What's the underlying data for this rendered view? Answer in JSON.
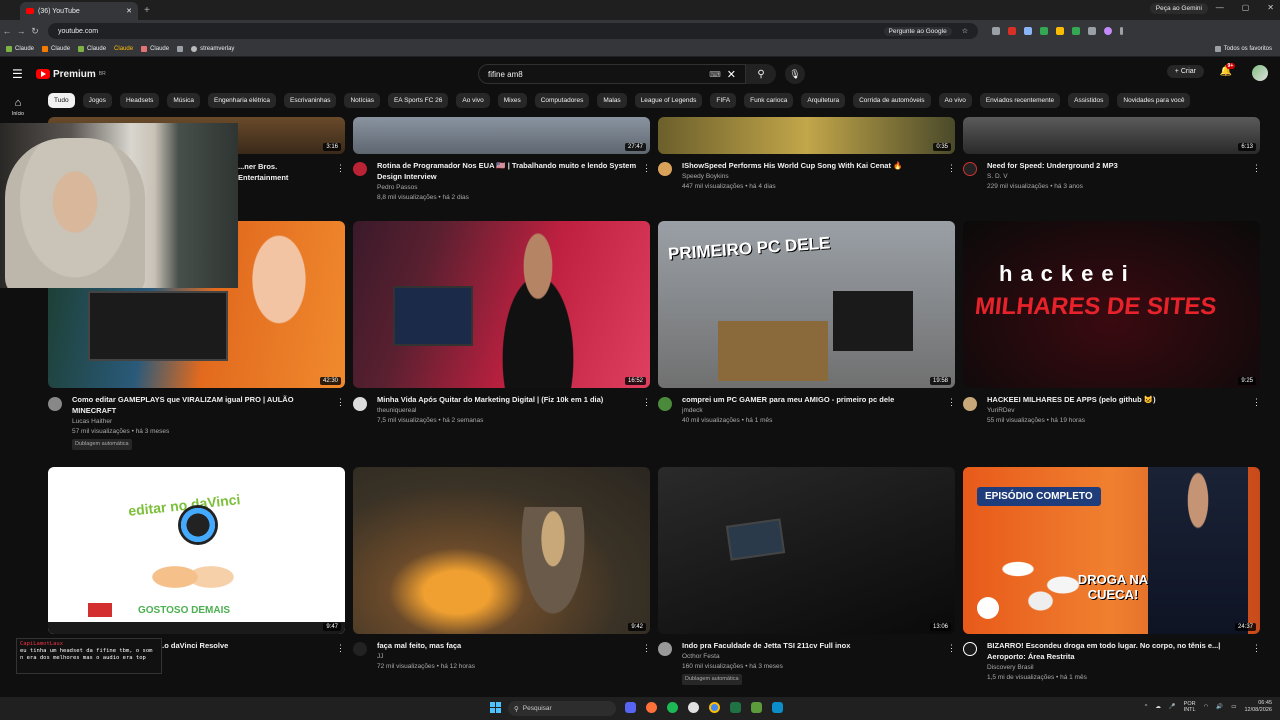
{
  "browser": {
    "tab_title": "(36) YouTube",
    "url": "youtube.com",
    "ask_google": "Pergunte ao Google",
    "gemini": "Peça ao Gemini",
    "bookmarks": [
      "Claude",
      "Claude",
      "Claude",
      "Claude",
      "Claude",
      "streamverlay"
    ],
    "all_bookmarks": "Todos os favoritos"
  },
  "youtube": {
    "logo_text": "Premium",
    "logo_sup": "BR",
    "search_value": "fifine am8",
    "create_label": "+ Criar",
    "notif_count": "9+",
    "home_label": "Início",
    "chips": [
      "Tudo",
      "Jogos",
      "Headsets",
      "Música",
      "Engenharia elétrica",
      "Escrivaninhas",
      "Notícias",
      "EA Sports FC 26",
      "Ao vivo",
      "Mixes",
      "Computadores",
      "Malas",
      "League of Legends",
      "FIFA",
      "Funk carioca",
      "Arquitetura",
      "Corrida de automóveis",
      "Ao vivo",
      "Enviados recentemente",
      "Assistidos",
      "Novidades para você"
    ]
  },
  "videos_row1": [
    {
      "title": "...ner Bros. Entertainment",
      "channel": "",
      "meta": "",
      "duration": "3:16"
    },
    {
      "title": "Rotina de Programador Nos EUA 🇺🇸 | Trabalhando muito e lendo System Design Interview",
      "channel": "Pedro Passos",
      "meta": "8,8 mil visualizações • há 2 dias",
      "duration": "27:47"
    },
    {
      "title": "IShowSpeed Performs His World Cup Song With Kai Cenat 🔥",
      "channel": "Speedy Boykins",
      "meta": "447 mil visualizações • há 4 dias",
      "duration": "0:35"
    },
    {
      "title": "Need for Speed: Underground 2 MP3",
      "channel": "S. D. V",
      "meta": "229 mil visualizações • há 3 anos",
      "duration": "6:13"
    }
  ],
  "videos_row2": [
    {
      "title": "Como editar GAMEPLAYS que VIRALIZAM igual PRO | AULÃO MINECRAFT",
      "channel": "Lucas Haither",
      "meta": "57 mil visualizações • há 3 meses",
      "badge": "Dublagem automática",
      "duration": "42:30"
    },
    {
      "title": "Minha Vida Após Quitar do Marketing Digital | (Fiz 10k em 1 dia)",
      "channel": "theuniquereal",
      "meta": "7,5 mil visualizações • há 2 semanas",
      "duration": "16:52"
    },
    {
      "title": "comprei um PC GAMER para meu AMIGO - primeiro pc dele",
      "channel": "jmdeck",
      "meta": "40 mil visualizações • há 1 mês",
      "duration": "19:58",
      "thumb_text": "PRIMEIRO PC DELE"
    },
    {
      "title": "HACKEEI MILHARES DE APPS (pelo github 😺)",
      "channel": "YuriRDev",
      "meta": "55 mil visualizações • há 19 horas",
      "duration": "9:25",
      "thumb_text1": "hackeei",
      "thumb_text2": "MILHARES DE SITES"
    }
  ],
  "videos_row3": [
    {
      "title": "...o daVinci Resolve",
      "channel": "",
      "meta": "",
      "duration": "9:47",
      "thumb_text1": "editar no daVinci",
      "thumb_text2": "GOSTOSO DEMAIS"
    },
    {
      "title": "faça mal feito, mas faça",
      "channel": "JJ",
      "meta": "72 mil visualizações • há 12 horas",
      "duration": "9:42"
    },
    {
      "title": "Indo pra Faculdade de Jetta TSI 211cv Full inox",
      "channel": "Octhor Festa",
      "meta": "160 mil visualizações • há 3 meses",
      "badge": "Dublagem automática",
      "duration": "13:06"
    },
    {
      "title": "BIZARRO! Escondeu droga em todo lugar. No corpo, no tênis e...| Aeroporto: Área Restrita",
      "channel": "Discovery Brasil",
      "meta": "1,5 mi de visualizações • há 1 mês",
      "duration": "24:37",
      "thumb_text1": "EPISÓDIO COMPLETO",
      "thumb_text2": "DROGA NA CUECA!"
    }
  ],
  "chat_overlay": {
    "user": "CapiLamotLaux",
    "text": "eu tinha um headset da fifine tbm, o som n era dos melhores mas o audio era top"
  },
  "taskbar": {
    "search": "Pesquisar",
    "lang1": "POR",
    "lang2": "INTL",
    "time": "06:45",
    "date": "12/08/2026"
  }
}
